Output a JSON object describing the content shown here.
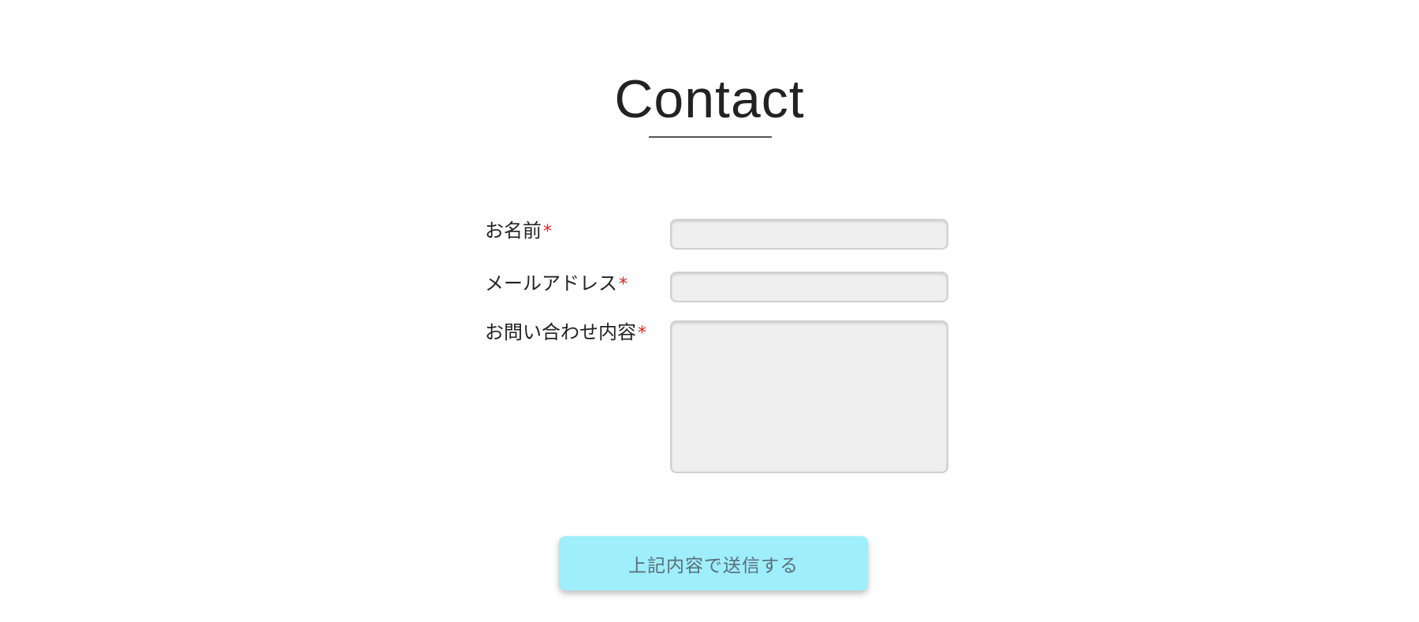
{
  "page": {
    "title": "Contact"
  },
  "form": {
    "required_mark": "*",
    "name": {
      "label": "お名前",
      "value": "",
      "placeholder": ""
    },
    "email": {
      "label": "メールアドレス",
      "value": "",
      "placeholder": ""
    },
    "message": {
      "label": "お問い合わせ内容",
      "value": "",
      "placeholder": ""
    },
    "submit_label": "上記内容で送信する"
  },
  "colors": {
    "required": "#e3211b",
    "submit_background": "#9feefb",
    "field_background": "#efefef"
  }
}
